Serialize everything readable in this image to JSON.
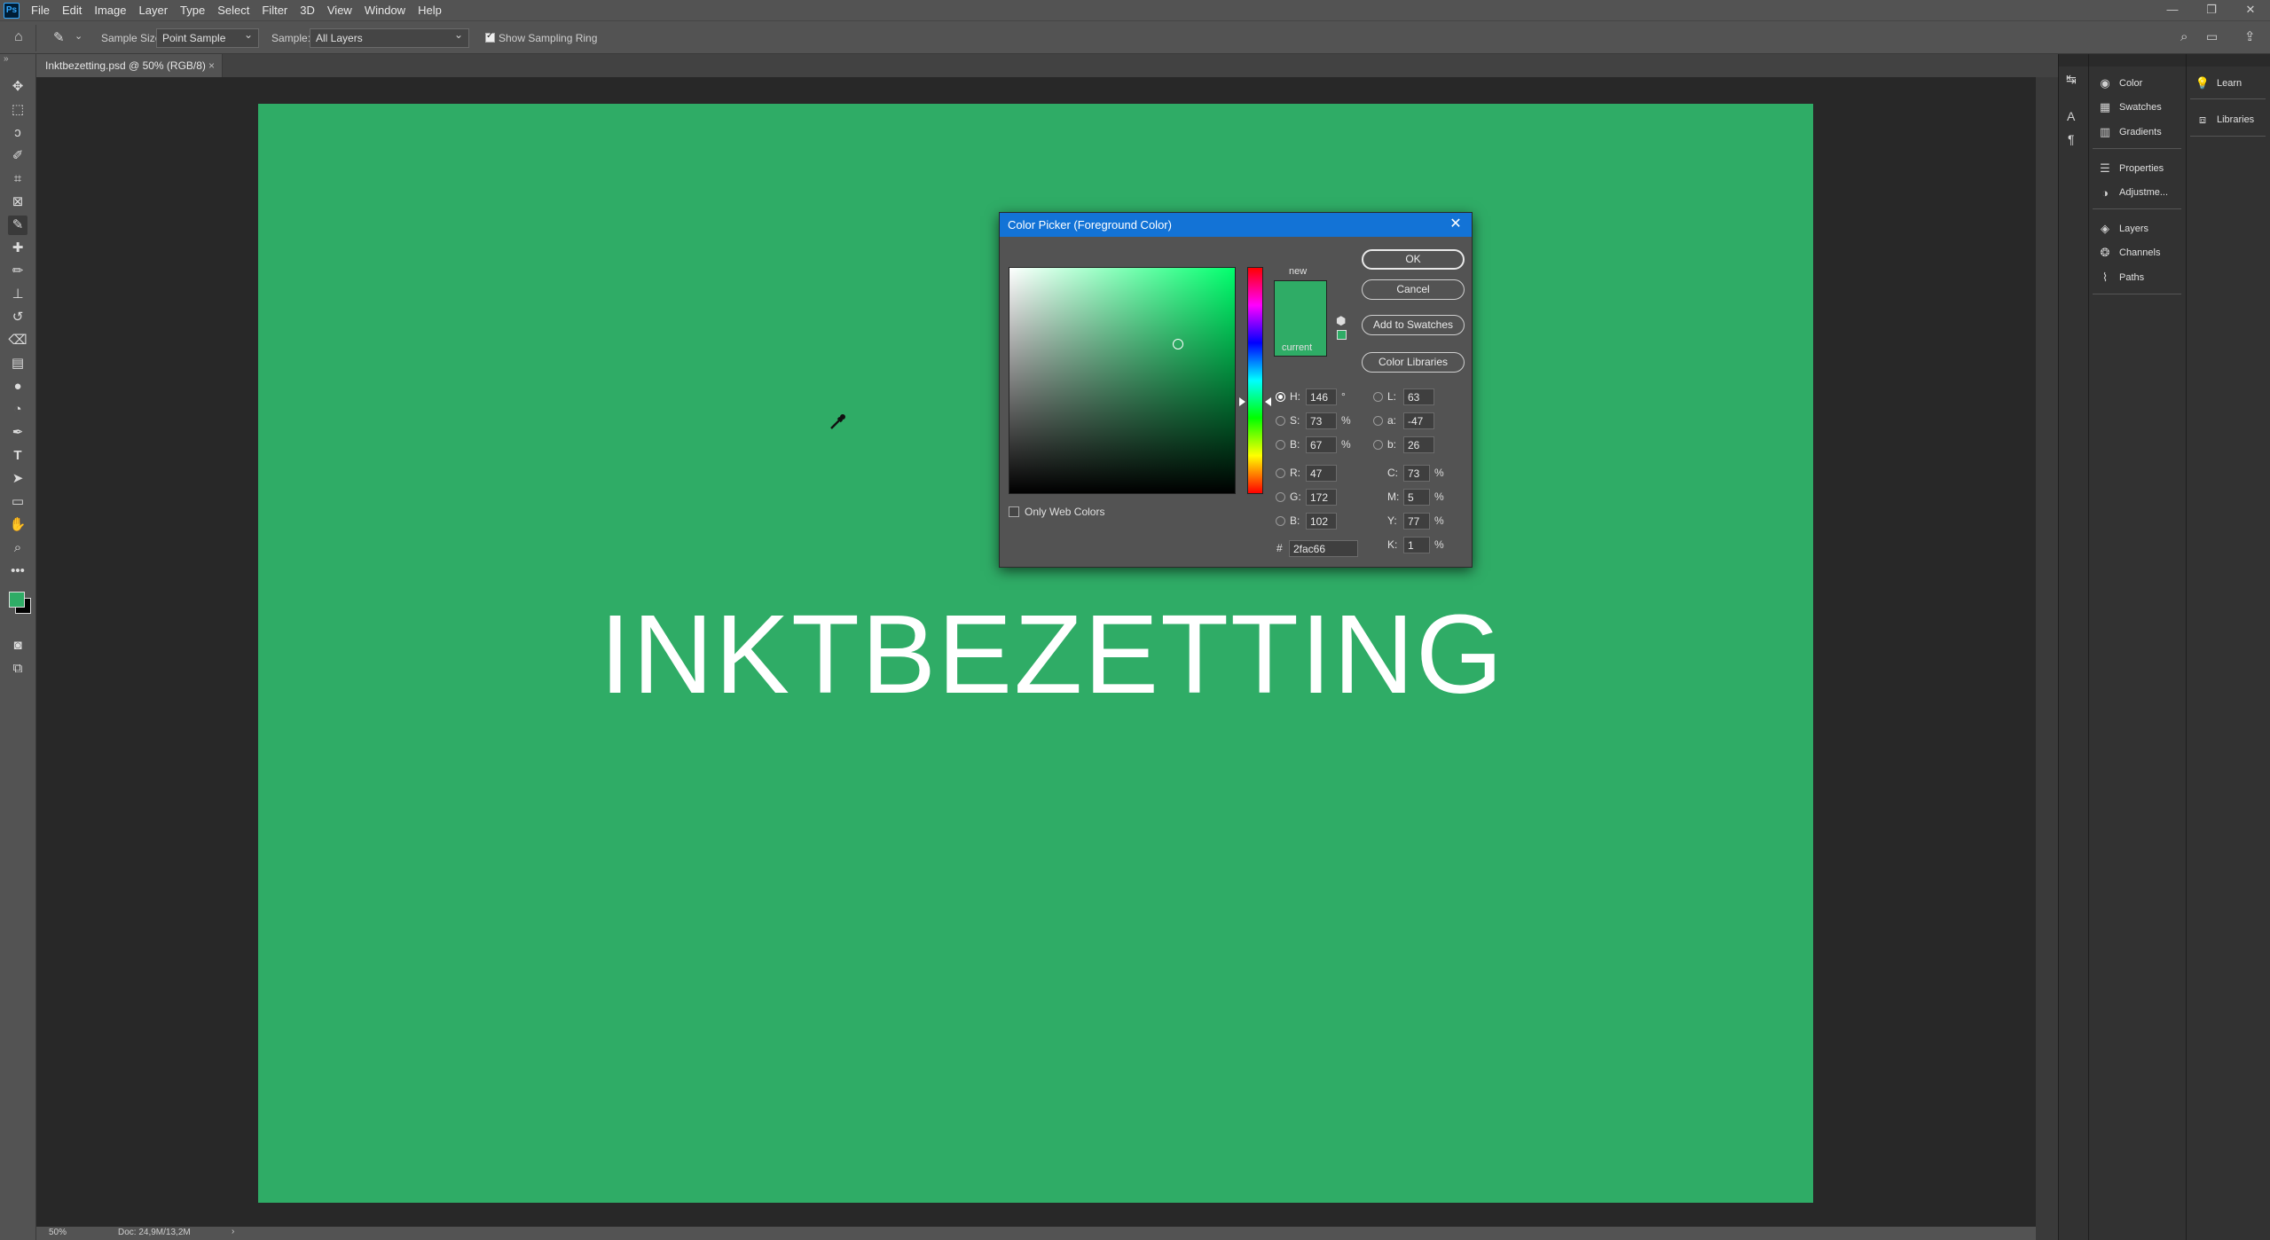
{
  "menubar": {
    "app_icon": "Ps",
    "items": [
      "File",
      "Edit",
      "Image",
      "Layer",
      "Type",
      "Select",
      "Filter",
      "3D",
      "View",
      "Window",
      "Help"
    ],
    "window_controls": {
      "minimize": "—",
      "restore": "❐",
      "close": "✕"
    }
  },
  "options_bar": {
    "sample_size_label": "Sample Size:",
    "sample_size_value": "Point Sample",
    "sample_label": "Sample:",
    "sample_value": "All Layers",
    "show_sampling_ring_label": "Show Sampling Ring",
    "show_sampling_ring_checked": true
  },
  "document": {
    "tab_title": "Inktbezetting.psd @ 50% (RGB/8)",
    "close_glyph": "×",
    "canvas_color": "#2fac66",
    "canvas_text": "INKTBEZETTING"
  },
  "status_bar": {
    "zoom": "50%",
    "doc_size": "Doc: 24,9M/13,2M",
    "arrow": "›"
  },
  "panels": {
    "column1": [
      "Color",
      "Swatches",
      "Gradients",
      "Properties",
      "Adjustme...",
      "Layers",
      "Channels",
      "Paths"
    ],
    "column2": [
      "Learn",
      "Libraries"
    ]
  },
  "color_picker": {
    "title": "Color Picker (Foreground Color)",
    "new_label": "new",
    "current_label": "current",
    "new_color": "#2fac66",
    "current_color": "#2fac66",
    "buttons": {
      "ok": "OK",
      "cancel": "Cancel",
      "add_to_swatches": "Add to Swatches",
      "color_libraries": "Color Libraries"
    },
    "only_web_colors_label": "Only Web Colors",
    "fields": {
      "H": {
        "label": "H:",
        "value": "146",
        "unit": "°"
      },
      "S": {
        "label": "S:",
        "value": "73",
        "unit": "%"
      },
      "Bv": {
        "label": "B:",
        "value": "67",
        "unit": "%"
      },
      "R": {
        "label": "R:",
        "value": "47"
      },
      "G": {
        "label": "G:",
        "value": "172"
      },
      "Bb": {
        "label": "B:",
        "value": "102"
      },
      "L": {
        "label": "L:",
        "value": "63"
      },
      "a": {
        "label": "a:",
        "value": "-47"
      },
      "b": {
        "label": "b:",
        "value": "26"
      },
      "C": {
        "label": "C:",
        "value": "73",
        "unit": "%"
      },
      "M": {
        "label": "M:",
        "value": "5",
        "unit": "%"
      },
      "Y": {
        "label": "Y:",
        "value": "77",
        "unit": "%"
      },
      "K": {
        "label": "K:",
        "value": "1",
        "unit": "%"
      },
      "hex_label": "#",
      "hex": "2fac66"
    }
  }
}
